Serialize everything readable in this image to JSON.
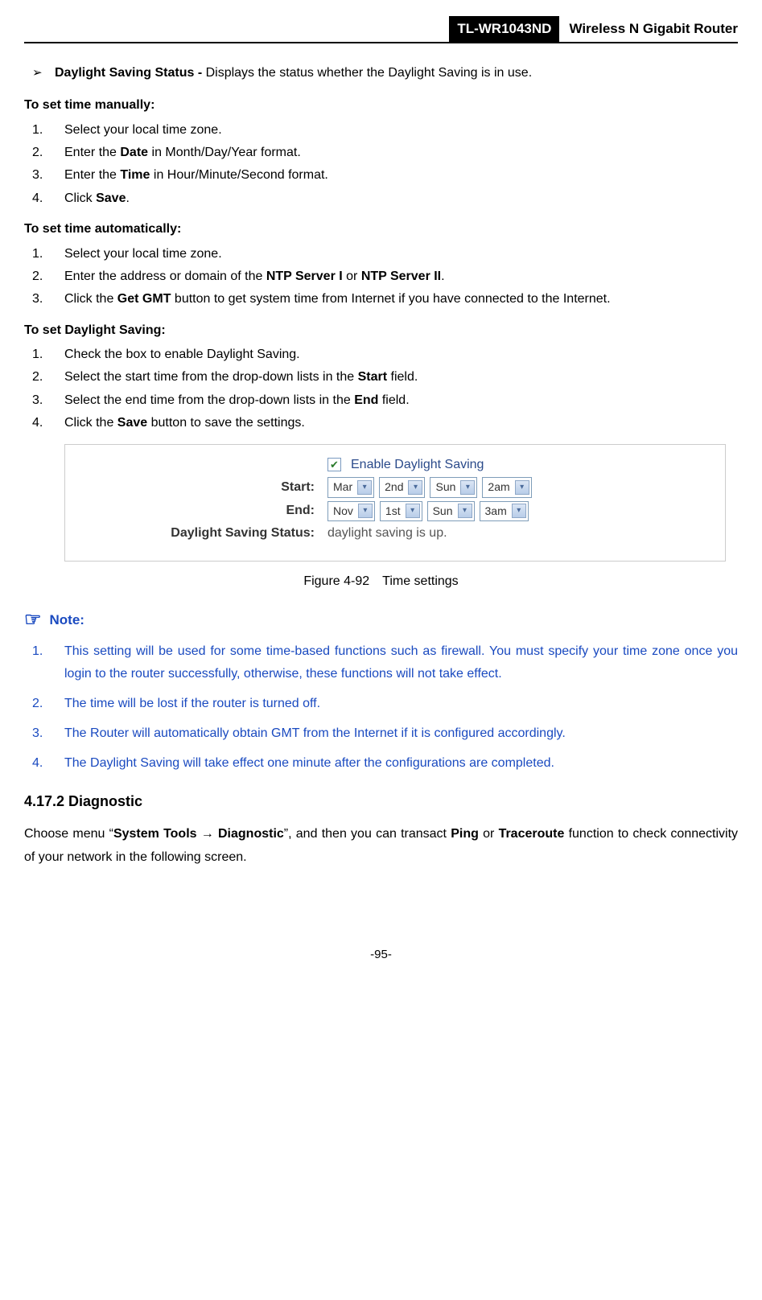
{
  "header": {
    "model": "TL-WR1043ND",
    "product": "Wireless N Gigabit Router"
  },
  "daylight_bullet": {
    "title": "Daylight Saving Status - ",
    "desc": "Displays the status whether the Daylight Saving is in use."
  },
  "manual": {
    "heading": "To set time manually:",
    "step1": "Select your local time zone.",
    "step2_pre": "Enter the ",
    "step2_bold": "Date",
    "step2_post": " in Month/Day/Year format.",
    "step3_pre": "Enter the ",
    "step3_bold": "Time",
    "step3_post": " in Hour/Minute/Second format.",
    "step4_pre": "Click ",
    "step4_bold": "Save",
    "step4_post": "."
  },
  "auto": {
    "heading": "To set time automatically:",
    "step1": "Select your local time zone.",
    "step2_pre": "Enter the address or domain of the ",
    "step2_b1": "NTP Server I",
    "step2_mid": " or ",
    "step2_b2": "NTP Server II",
    "step2_post": ".",
    "step3_pre": "Click the ",
    "step3_bold": "Get GMT",
    "step3_post": " button to get system time from Internet if you have connected to the Internet."
  },
  "ds": {
    "heading": "To set Daylight Saving:",
    "step1": "Check the box to enable Daylight Saving.",
    "step2_pre": "Select the start time from the drop-down lists in the ",
    "step2_bold": "Start",
    "step2_post": " field.",
    "step3_pre": "Select the end time from the drop-down lists in the ",
    "step3_bold": "End",
    "step3_post": " field.",
    "step4_pre": "Click the ",
    "step4_bold": "Save",
    "step4_post": " button to save the settings."
  },
  "figure": {
    "enable_label": "Enable Daylight Saving",
    "start_label": "Start:",
    "end_label": "End:",
    "status_label": "Daylight Saving Status:",
    "status_value": "daylight saving is up.",
    "start_vals": {
      "a": "Mar",
      "b": "2nd",
      "c": "Sun",
      "d": "2am"
    },
    "end_vals": {
      "a": "Nov",
      "b": "1st",
      "c": "Sun",
      "d": "3am"
    },
    "caption": "Figure 4-92 Time settings"
  },
  "note": {
    "heading": "Note:",
    "n1": "This setting will be used for some time-based functions such as firewall. You must specify your time zone once you login to the router successfully, otherwise, these functions will not take effect.",
    "n2": "The time will be lost if the router is turned off.",
    "n3": "The Router will automatically obtain GMT from the Internet if it is configured accordingly.",
    "n4": "The Daylight Saving will take effect one minute after the configurations are completed."
  },
  "diag": {
    "heading": "4.17.2  Diagnostic",
    "p_pre": "Choose menu “",
    "p_b1": "System Tools",
    "p_arrow": " → ",
    "p_b2": "Diagnostic",
    "p_mid": "”, and then you can transact ",
    "p_b3": "Ping",
    "p_or": " or ",
    "p_b4": "Traceroute",
    "p_post": " function to check connectivity of your network in the following screen."
  },
  "footer": "-95-"
}
